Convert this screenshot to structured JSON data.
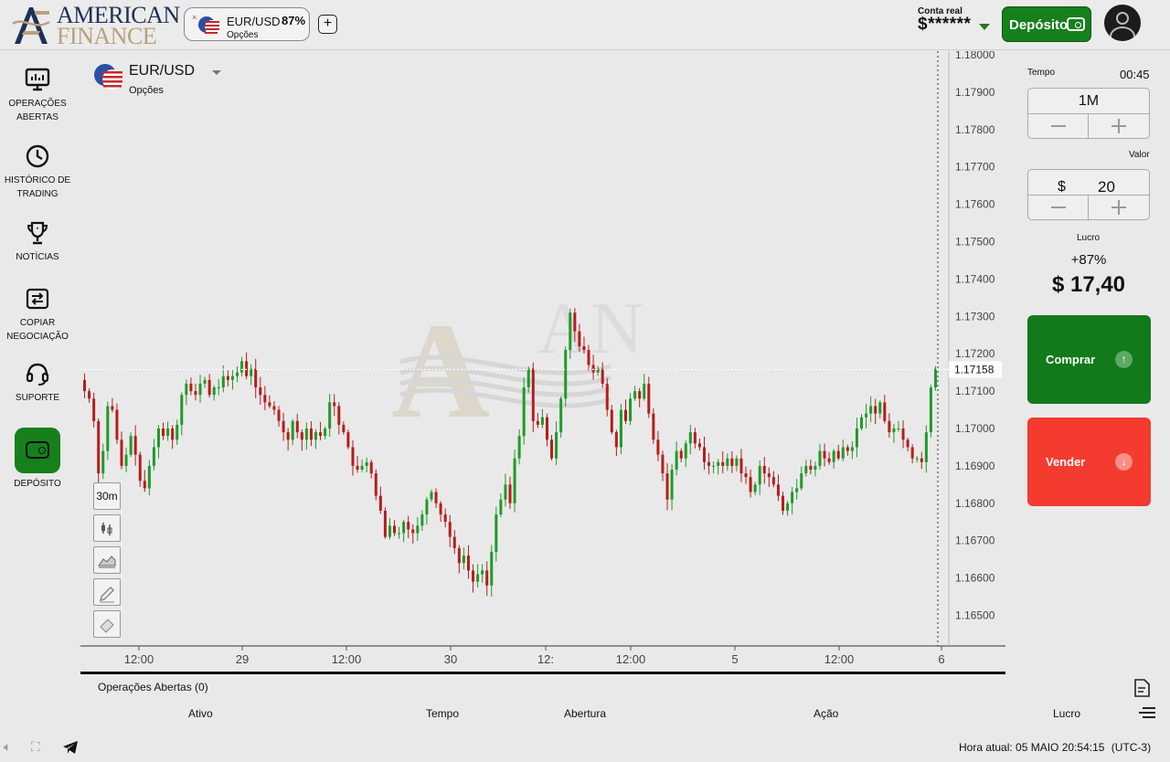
{
  "brand": {
    "line1": "AMERICAN",
    "line2": "FINANCE"
  },
  "header": {
    "asset_pill": {
      "close": "×",
      "symbol": "EUR/USD",
      "payout": "87%",
      "type": "Opções"
    },
    "add_label": "+",
    "account": {
      "label": "Conta real",
      "balance": "$******"
    },
    "deposit_label": "Depósito"
  },
  "sidebar": {
    "items": [
      {
        "label": "OPERAÇÕES ABERTAS",
        "icon": "monitor-icon"
      },
      {
        "label": "HISTÓRICO DE TRADING",
        "icon": "clock-icon"
      },
      {
        "label": "NOTÍCIAS",
        "icon": "trophy-icon"
      },
      {
        "label": "COPIAR NEGOCIAÇÃO",
        "icon": "copy-trade-icon"
      },
      {
        "label": "SUPORTE",
        "icon": "headset-icon"
      },
      {
        "label": "DEPÓSITO",
        "icon": "wallet-icon"
      }
    ]
  },
  "chart_header": {
    "symbol": "EUR/USD",
    "type": "Opções"
  },
  "chart_tools": {
    "timeframe": "30m",
    "tools": [
      "candle-type-icon",
      "area-chart-icon",
      "draw-icon",
      "eraser-icon"
    ]
  },
  "chart_data": {
    "type": "candlestick",
    "title": "",
    "y_ticks": [
      "1.18000",
      "1.17900",
      "1.17800",
      "1.17700",
      "1.17600",
      "1.17500",
      "1.17400",
      "1.17300",
      "1.17200",
      "1.17100",
      "1.17000",
      "1.16900",
      "1.16800",
      "1.16700",
      "1.16600",
      "1.16500"
    ],
    "ylim": [
      1.1649,
      1.1803
    ],
    "x_ticks": [
      "12:00",
      "29",
      "12:00",
      "30",
      "12:",
      "12:00",
      "5",
      "12:00",
      "6"
    ],
    "current_price": "1.17158",
    "close_path": [
      1.171,
      1.1708,
      1.1702,
      1.1688,
      1.1694,
      1.1706,
      1.1705,
      1.1697,
      1.169,
      1.1693,
      1.1698,
      1.1693,
      1.1686,
      1.1684,
      1.169,
      1.1695,
      1.17,
      1.1698,
      1.17,
      1.1697,
      1.1701,
      1.1709,
      1.1712,
      1.171,
      1.1709,
      1.1712,
      1.1713,
      1.1709,
      1.1711,
      1.1711,
      1.1714,
      1.1713,
      1.1714,
      1.1715,
      1.1718,
      1.1714,
      1.1716,
      1.1711,
      1.1709,
      1.1707,
      1.1706,
      1.1705,
      1.1702,
      1.1699,
      1.1697,
      1.1702,
      1.1699,
      1.1697,
      1.17,
      1.1697,
      1.1699,
      1.1698,
      1.17,
      1.1707,
      1.1706,
      1.1701,
      1.1699,
      1.1695,
      1.169,
      1.1689,
      1.169,
      1.1691,
      1.1688,
      1.1682,
      1.1678,
      1.1671,
      1.1674,
      1.1672,
      1.1672,
      1.1675,
      1.1673,
      1.1672,
      1.1674,
      1.1677,
      1.1681,
      1.1683,
      1.168,
      1.1677,
      1.1675,
      1.1671,
      1.1668,
      1.1664,
      1.1666,
      1.1662,
      1.1659,
      1.1661,
      1.1662,
      1.1658,
      1.1667,
      1.1677,
      1.1681,
      1.1685,
      1.168,
      1.1692,
      1.1698,
      1.1711,
      1.1716,
      1.1702,
      1.1701,
      1.1703,
      1.1697,
      1.1692,
      1.1699,
      1.1708,
      1.1721,
      1.1731,
      1.1726,
      1.1722,
      1.1721,
      1.1717,
      1.1715,
      1.1716,
      1.1712,
      1.1705,
      1.1699,
      1.1695,
      1.1705,
      1.1702,
      1.1708,
      1.171,
      1.1708,
      1.1712,
      1.1704,
      1.1697,
      1.1693,
      1.1688,
      1.1681,
      1.1689,
      1.1694,
      1.1692,
      1.1696,
      1.1699,
      1.1696,
      1.1695,
      1.1691,
      1.169,
      1.169,
      1.1691,
      1.169,
      1.1692,
      1.169,
      1.1692,
      1.1688,
      1.1687,
      1.1683,
      1.1685,
      1.169,
      1.1688,
      1.1687,
      1.1685,
      1.1682,
      1.1678,
      1.168,
      1.1683,
      1.1684,
      1.1688,
      1.169,
      1.1689,
      1.169,
      1.1694,
      1.1692,
      1.1691,
      1.1694,
      1.1692,
      1.1695,
      1.1694,
      1.1695,
      1.17,
      1.1703,
      1.1704,
      1.1706,
      1.1704,
      1.1707,
      1.1702,
      1.1699,
      1.17,
      1.17,
      1.1697,
      1.1695,
      1.1692,
      1.1692,
      1.1691,
      1.1699,
      1.1711,
      1.1716
    ]
  },
  "right_panel": {
    "time_label": "Tempo",
    "timer": "00:45",
    "duration": "1M",
    "value_label": "Valor",
    "currency": "$",
    "amount": "20",
    "profit_label": "Lucro",
    "profit_pct": "+87%",
    "profit_value": "$ 17,40",
    "buy_label": "Comprar",
    "sell_label": "Vender"
  },
  "bottom": {
    "tab_label": "Operações Abertas (0)",
    "columns": [
      "Ativo",
      "Tempo",
      "Abertura",
      "Ação",
      "Lucro"
    ]
  },
  "footer": {
    "time_label": "Hora atual: 05 MAIO 20:54:15",
    "tz": "(UTC-3)"
  },
  "colors": {
    "accent": "#15801c",
    "buy": "#127a1b",
    "sell": "#f33b2f",
    "candle_up": "#1f9a2a",
    "candle_down": "#b71c1c"
  }
}
